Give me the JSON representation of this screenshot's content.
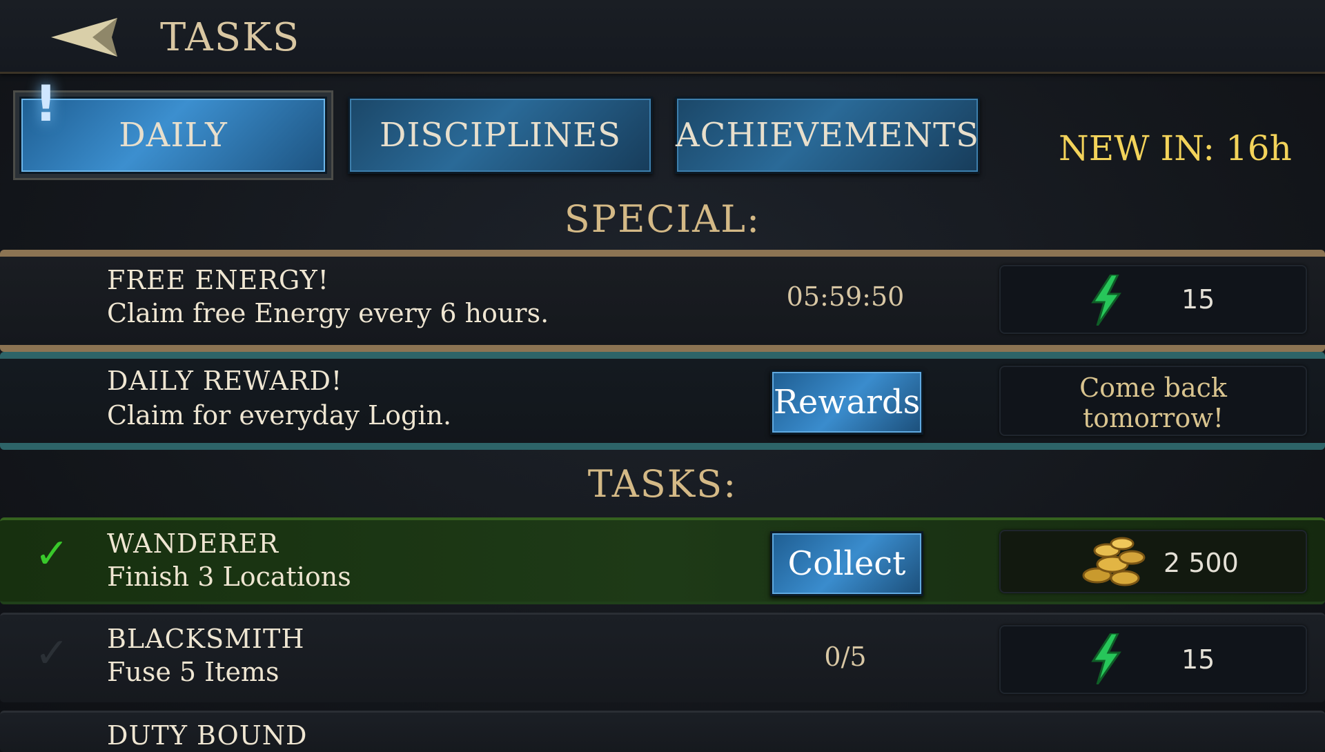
{
  "header": {
    "title": "TASKS"
  },
  "tabs": [
    {
      "label": "DAILY",
      "active": true
    },
    {
      "label": "DISCIPLINES",
      "active": false
    },
    {
      "label": "ACHIEVEMENTS",
      "active": false
    }
  ],
  "alert_mark": "!",
  "new_in": "NEW IN: 16h",
  "special": {
    "title": "SPECIAL:",
    "items": [
      {
        "name": "FREE ENERGY!",
        "desc": "Claim free Energy every 6 hours.",
        "timer": "05:59:50",
        "reward_icon": "energy-bolt-icon",
        "reward_value": "15"
      },
      {
        "name": "DAILY REWARD!",
        "desc": "Claim for everyday Login.",
        "button": "Rewards",
        "status_line1": "Come back",
        "status_line2": "tomorrow!"
      }
    ]
  },
  "tasks": {
    "title": "TASKS:",
    "items": [
      {
        "name": "WANDERER",
        "desc": "Finish 3 Locations",
        "completed": true,
        "button": "Collect",
        "check": "✓",
        "reward_icon": "gold-coins-icon",
        "reward_value": "2 500"
      },
      {
        "name": "BLACKSMITH",
        "desc": "Fuse 5 Items",
        "completed": false,
        "progress": "0/5",
        "check": "✓",
        "reward_icon": "energy-bolt-icon",
        "reward_value": "15"
      },
      {
        "name": "DUTY BOUND"
      }
    ]
  },
  "colors": {
    "accent_gold": "#f3d35a",
    "tab_blue": "#2a6a98",
    "completed_green": "#1e3a17"
  }
}
